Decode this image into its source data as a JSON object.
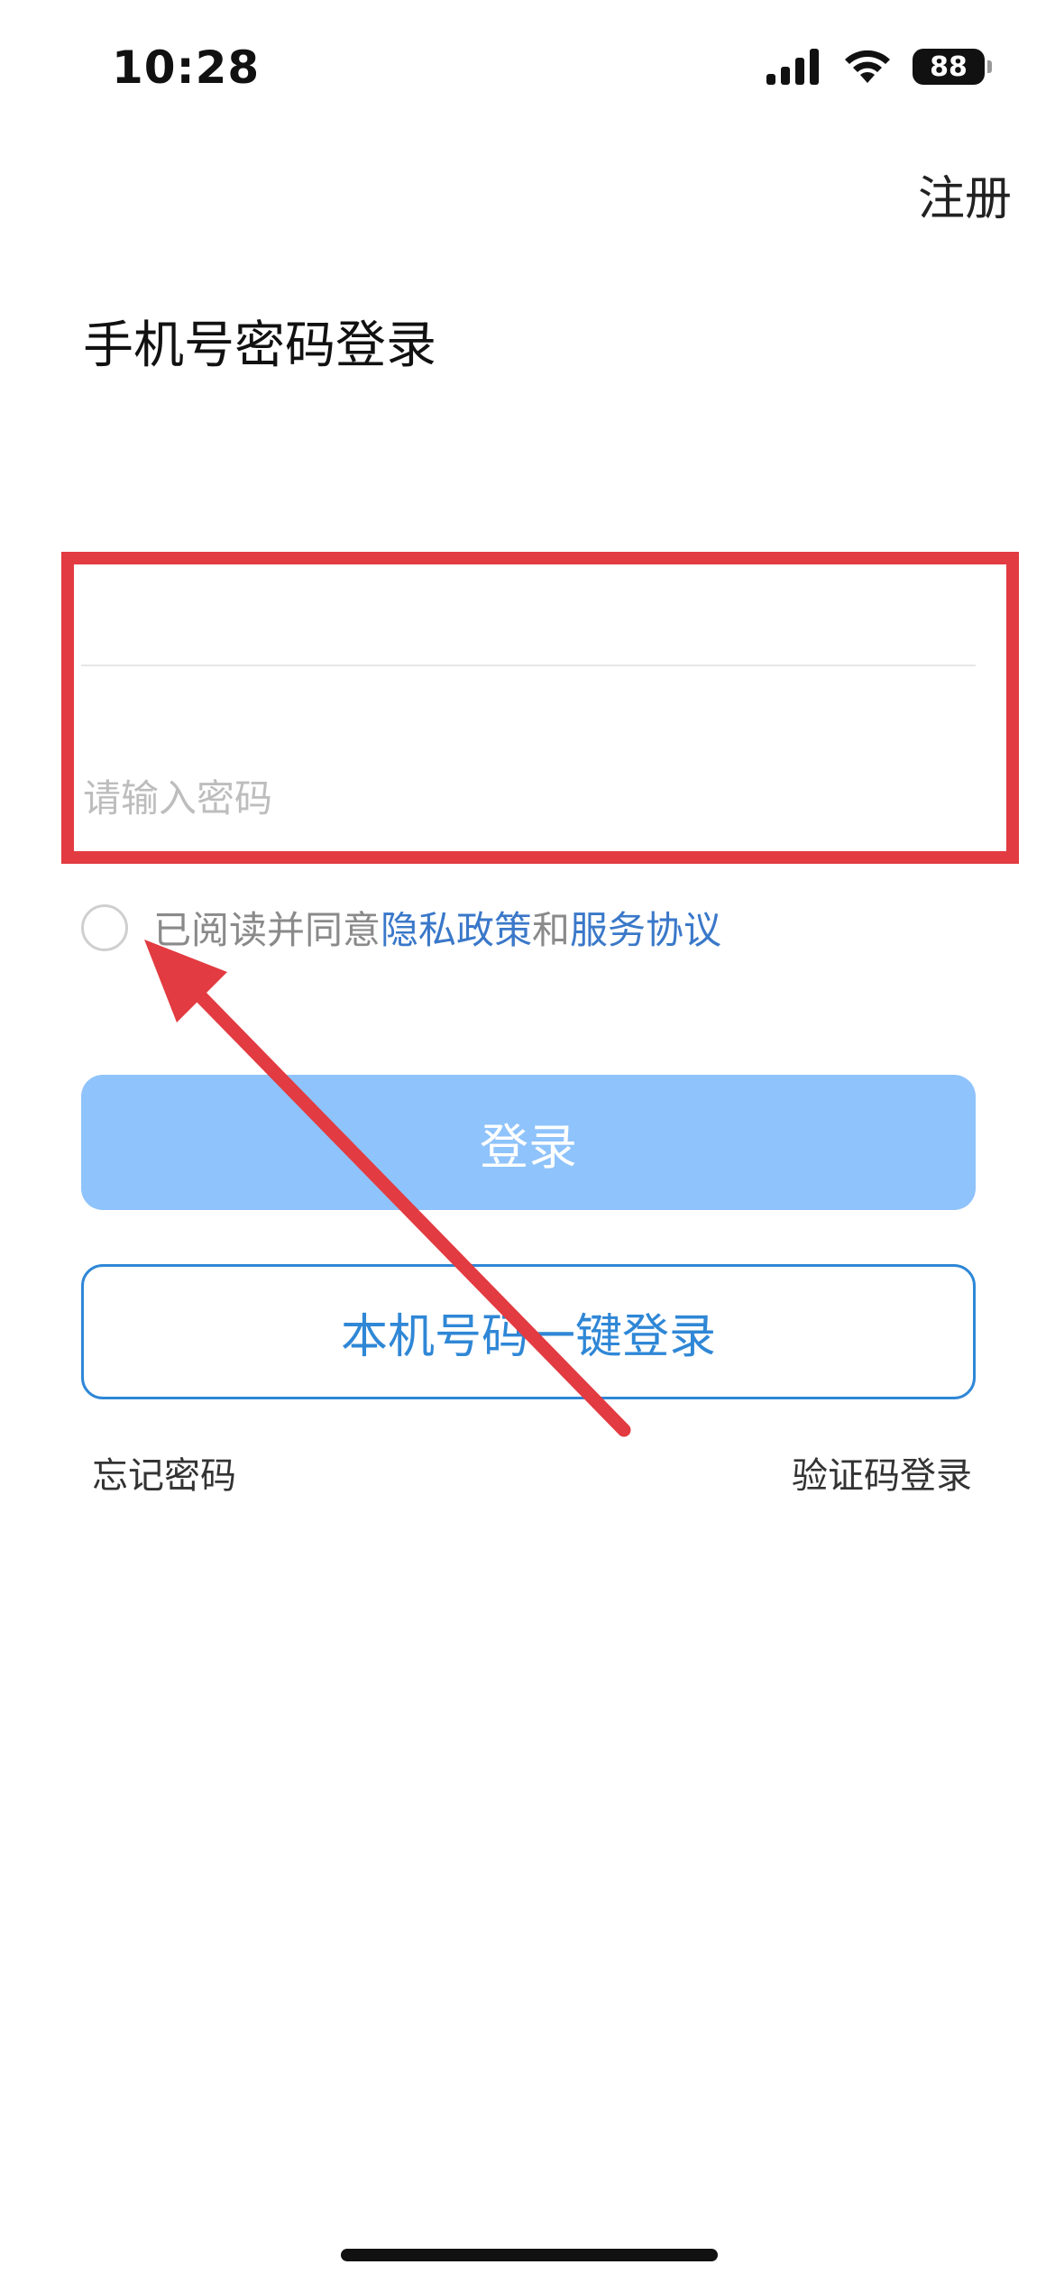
{
  "status_bar": {
    "time": "10:28",
    "battery": "88"
  },
  "header": {
    "register_label": "注册",
    "title": "手机号密码登录"
  },
  "form": {
    "phone_value": "",
    "password_placeholder": "请输入密码"
  },
  "agreement": {
    "prefix": "已阅读并同意",
    "privacy_link": "隐私政策",
    "and": "和",
    "service_link": "服务协议"
  },
  "buttons": {
    "login": "登录",
    "one_key_login": "本机号码一键登录"
  },
  "links": {
    "forgot_password": "忘记密码",
    "sms_login": "验证码登录"
  },
  "colors": {
    "annotation_red": "#e23b41",
    "login_button_bg": "#8fc3fb",
    "accent_blue": "#2f87d6",
    "link_blue": "#3a78c9"
  }
}
